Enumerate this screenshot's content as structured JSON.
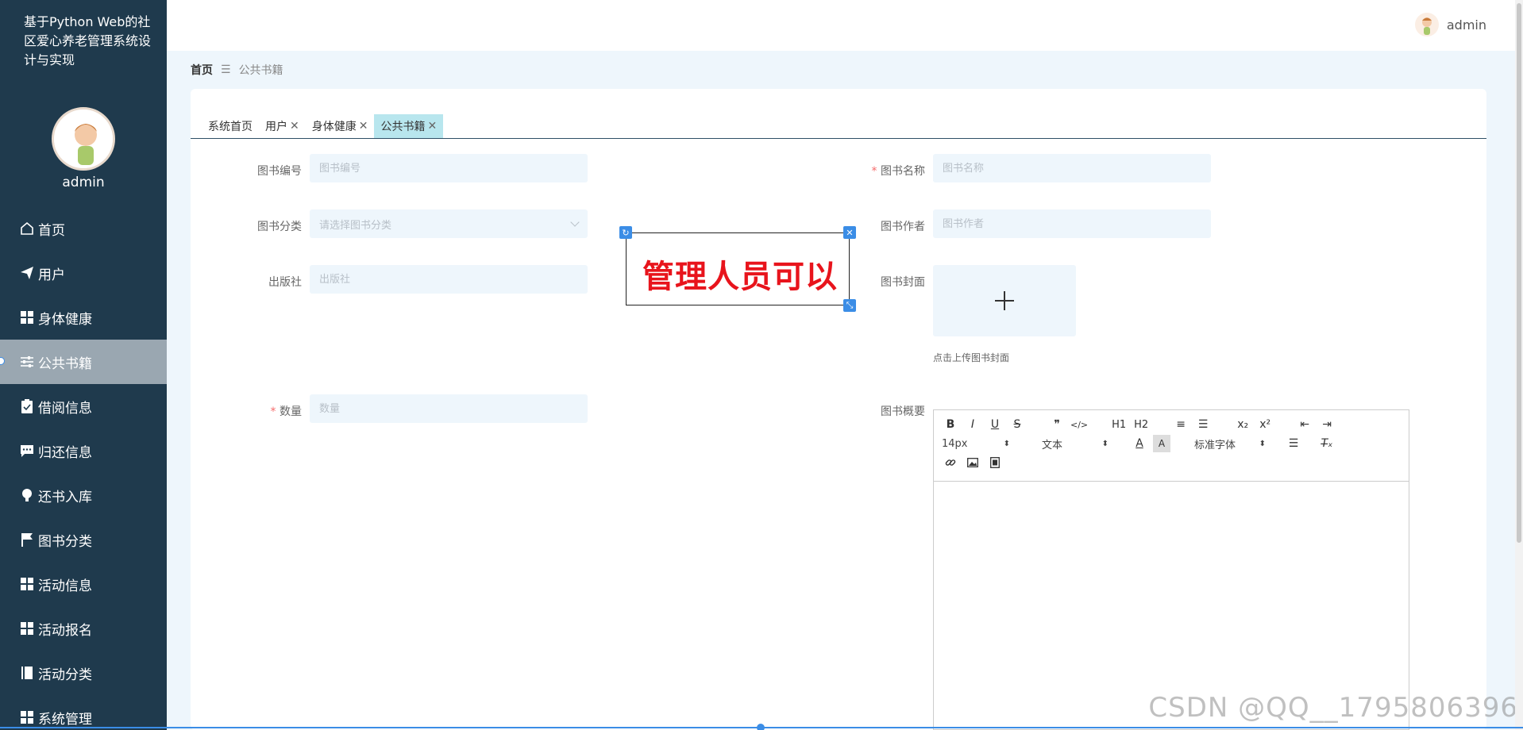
{
  "sidebar": {
    "app_title": "基于Python Web的社区爱心养老管理系统设计与实现",
    "username": "admin",
    "items": [
      {
        "label": "首页",
        "icon": "home-icon"
      },
      {
        "label": "用户",
        "icon": "send-icon"
      },
      {
        "label": "身体健康",
        "icon": "grid-icon"
      },
      {
        "label": "公共书籍",
        "icon": "sliders-icon",
        "active": true
      },
      {
        "label": "借阅信息",
        "icon": "clipboard-icon"
      },
      {
        "label": "归还信息",
        "icon": "chat-icon"
      },
      {
        "label": "还书入库",
        "icon": "bulb-icon"
      },
      {
        "label": "图书分类",
        "icon": "flag-icon"
      },
      {
        "label": "活动信息",
        "icon": "grid-icon"
      },
      {
        "label": "活动报名",
        "icon": "grid-icon"
      },
      {
        "label": "活动分类",
        "icon": "book-icon"
      },
      {
        "label": "系统管理",
        "icon": "grid-icon"
      }
    ]
  },
  "header": {
    "username": "admin"
  },
  "breadcrumb": {
    "home": "首页",
    "separator": "☰",
    "current": "公共书籍"
  },
  "tabs": [
    {
      "label": "系统首页",
      "closable": false
    },
    {
      "label": "用户",
      "closable": true
    },
    {
      "label": "身体健康",
      "closable": true
    },
    {
      "label": "公共书籍",
      "closable": true,
      "active": true
    }
  ],
  "form": {
    "book_no": {
      "label": "图书编号",
      "placeholder": "图书编号"
    },
    "book_name": {
      "label": "图书名称",
      "placeholder": "图书名称",
      "required": true
    },
    "category": {
      "label": "图书分类",
      "placeholder": "请选择图书分类"
    },
    "author": {
      "label": "图书作者",
      "placeholder": "图书作者"
    },
    "publisher": {
      "label": "出版社",
      "placeholder": "出版社"
    },
    "cover": {
      "label": "图书封面",
      "hint": "点击上传图书封面"
    },
    "quantity": {
      "label": "数量",
      "placeholder": "数量",
      "required": true
    },
    "summary": {
      "label": "图书概要"
    }
  },
  "editor": {
    "font_size": "14px",
    "header_select": "文本",
    "font_family": "标准字体",
    "row1": [
      "B",
      "I",
      "U",
      "S",
      "❞",
      "</>",
      "H1",
      "H2",
      "≡",
      "☰",
      "x₂",
      "x²",
      "⇤",
      "⇥"
    ]
  },
  "overlay": {
    "text": "管理人员可以"
  },
  "watermark": "CSDN @QQ__1795806396",
  "colors": {
    "sidebar": "#1f3a4d",
    "active_tab": "#b8e6ee",
    "overlay_text": "#e8141c",
    "accent": "#3b8de6"
  }
}
